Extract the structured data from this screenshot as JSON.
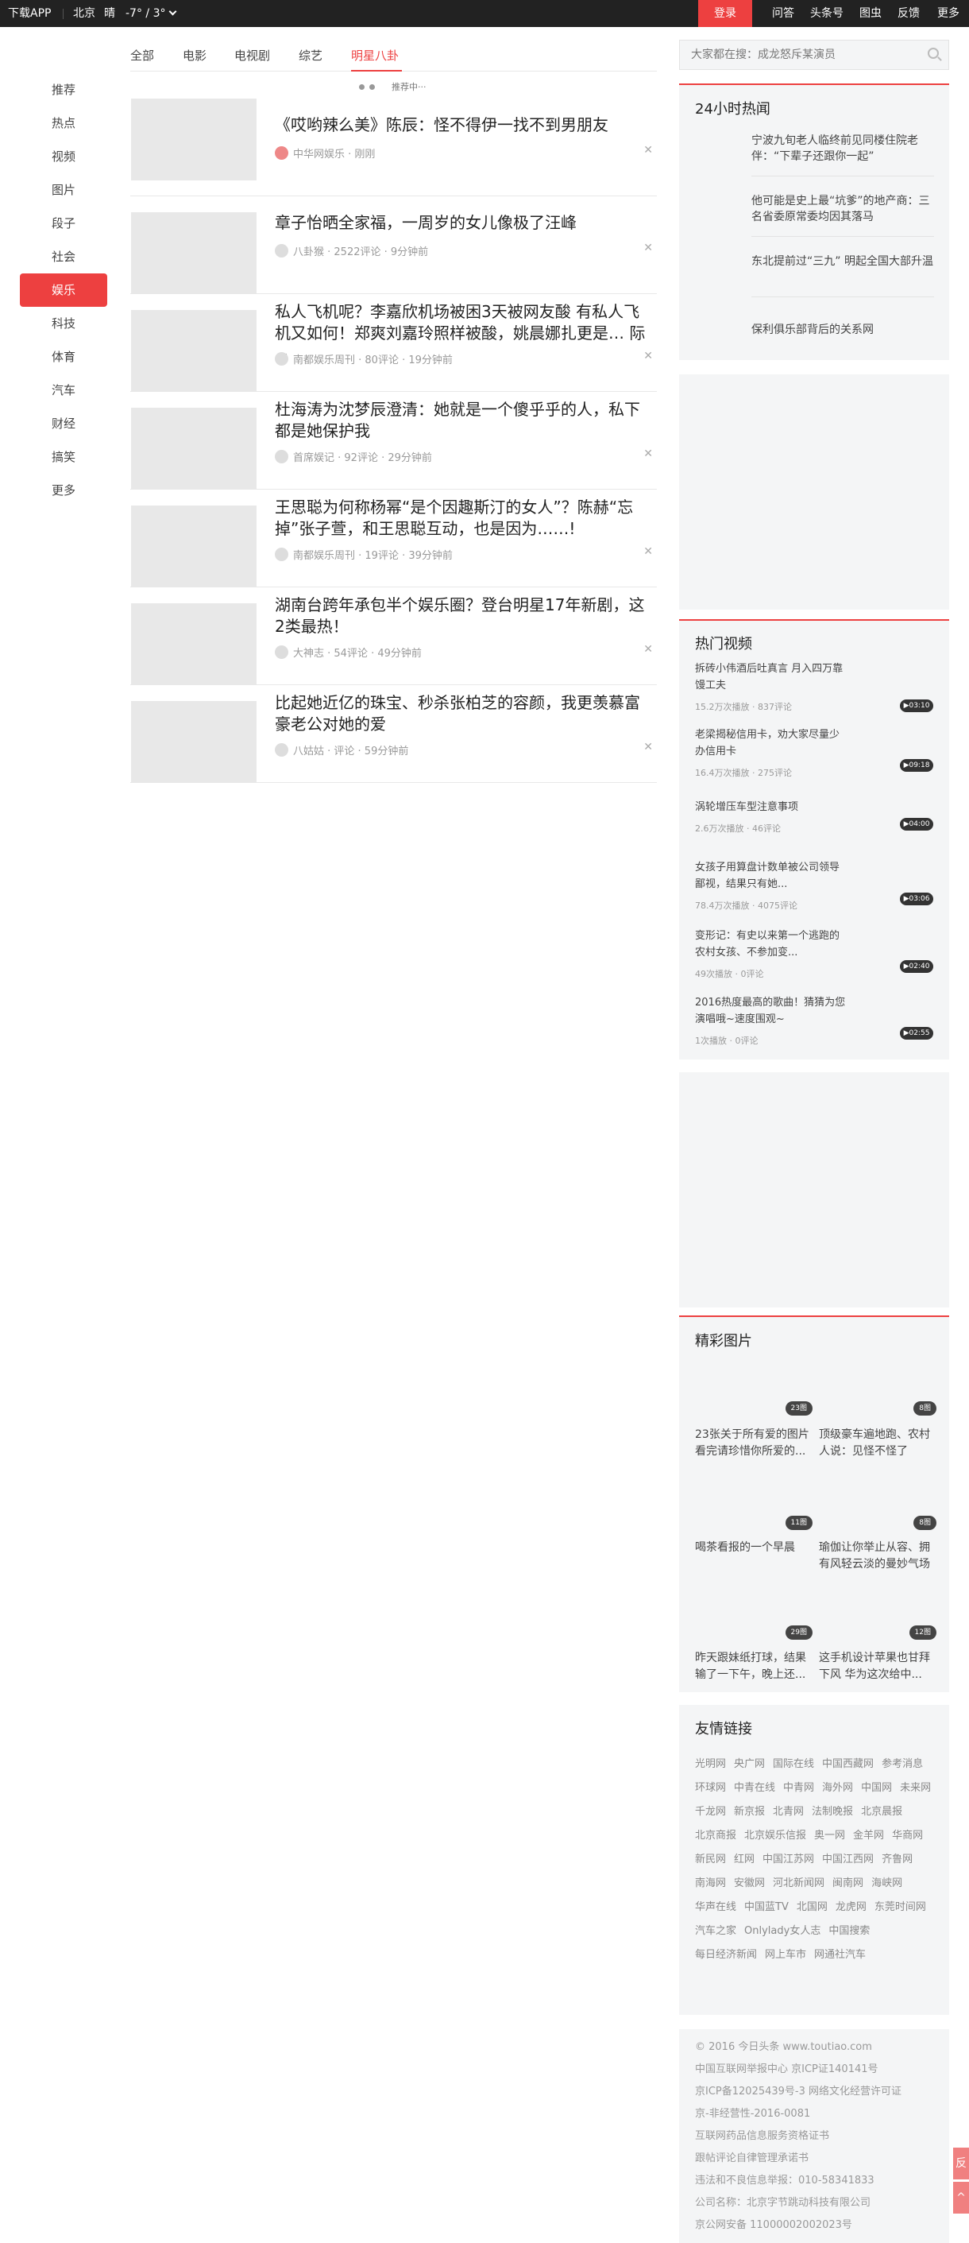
{
  "topbar": {
    "download_app": "下载APP",
    "city": "北京",
    "weather": "晴",
    "temp": "-7° / 3°",
    "login": "登录",
    "nav": [
      "问答",
      "头条号",
      "图虫",
      "反馈",
      "更多"
    ]
  },
  "sidebar": {
    "items": [
      "推荐",
      "热点",
      "视频",
      "图片",
      "段子",
      "社会",
      "娱乐",
      "科技",
      "体育",
      "汽车",
      "财经",
      "搞笑",
      "更多"
    ],
    "active": "娱乐"
  },
  "tabs": {
    "items": [
      "全部",
      "电影",
      "电视剧",
      "综艺",
      "明星八卦"
    ],
    "active": "明星八卦"
  },
  "pull_text": "推荐中···",
  "feed": [
    {
      "title": "《哎哟辣么美》陈辰：怪不得伊一找不到男朋友",
      "meta": "中华网娱乐 · 刚刚"
    },
    {
      "title": "章子怡晒全家福，一周岁的女儿像极了汪峰",
      "meta": "八卦猴 · 2522评论 · 9分钟前"
    },
    {
      "title": "私人飞机呢？李嘉欣机场被困3天被网友酸 有私人飞机又如何！郑爽刘嘉玲照样被酸，姚晨娜扎更是… 际~",
      "meta": "南都娱乐周刊 · 80评论 · 19分钟前"
    },
    {
      "title": "杜海涛为沈梦辰澄清：她就是一个傻乎乎的人，私下都是她保护我",
      "meta": "首席娱记 · 92评论 · 29分钟前"
    },
    {
      "title": "王思聪为何称杨幂“是个因趣斯汀的女人”？陈赫“忘掉”张子萱，和王思聪互动，也是因为……!",
      "meta": "南都娱乐周刊 · 19评论 · 39分钟前"
    },
    {
      "title": "湖南台跨年承包半个娱乐圈？登台明星17年新剧，这2类最热！",
      "meta": "大神志 · 54评论 · 49分钟前"
    },
    {
      "title": "比起她近亿的珠宝、秒杀张柏芝的容颜，我更羡慕富豪老公对她的爱",
      "meta": "八姑姑 · 评论 · 59分钟前"
    }
  ],
  "search": {
    "placeholder": "大家都在搜：成龙怒斥某演员"
  },
  "hot24": {
    "title": "24小时热闻",
    "items": [
      "宁波九旬老人临终前见同楼住院老伴：“下辈子还跟你一起”",
      "他可能是史上最“坑爹”的地产商：三名省委原常委均因其落马",
      "东北提前过“三九” 明起全国大部升温",
      "保利俱乐部背后的关系网"
    ]
  },
  "hotvideo": {
    "title": "热门视频",
    "items": [
      {
        "title": "拆砖小伟酒后吐真言 月入四万靠馒工夫",
        "meta": "15.2万次播放 · 837评论",
        "dur": "▶03:10"
      },
      {
        "title": "老梁揭秘信用卡，劝大家尽量少办信用卡",
        "meta": "16.4万次播放 · 275评论",
        "dur": "▶09:18"
      },
      {
        "title": "涡轮增压车型注意事项",
        "meta": "2.6万次播放 · 46评论",
        "dur": "▶04:00"
      },
      {
        "title": "女孩子用算盘计数单被公司领导鄙视，结果只有她...",
        "meta": "78.4万次播放 · 4075评论",
        "dur": "▶03:06"
      },
      {
        "title": "变形记：有史以来第一个逃跑的农村女孩、不参加变...",
        "meta": "49次播放 · 0评论",
        "dur": "▶02:40"
      },
      {
        "title": "2016热度最高的歌曲！猜猜为您演唱哦~速度围观~",
        "meta": "1次播放 · 0评论",
        "dur": "▶02:55"
      }
    ]
  },
  "pictures": {
    "title": "精彩图片",
    "items": [
      {
        "title": "23张关于所有爱的图片 看完请珍惜你所爱的...",
        "badge": "23图"
      },
      {
        "title": "顶级豪车遍地跑、农村人说：见怪不怪了",
        "badge": "8图"
      },
      {
        "title": "喝茶看报的一个早晨",
        "badge": "11图"
      },
      {
        "title": "瑜伽让你举止从容、拥有风轻云淡的曼妙气场",
        "badge": "8图"
      },
      {
        "title": "昨天跟妹纸打球，结果输了一下午，晚上还...",
        "badge": "29图"
      },
      {
        "title": "这手机设计苹果也甘拜下风 华为这次给中...",
        "badge": "12图"
      }
    ]
  },
  "friend_links": {
    "title": "友情链接",
    "items": [
      "光明网",
      "央广网",
      "国际在线",
      "中国西藏网",
      "参考消息",
      "环球网",
      "中青在线",
      "中青网",
      "海外网",
      "中国网",
      "未来网",
      "千龙网",
      "新京报",
      "北青网",
      "法制晚报",
      "北京晨报",
      "北京商报",
      "北京娱乐信报",
      "奥一网",
      "金羊网",
      "华商网",
      "新民网",
      "红网",
      "中国江苏网",
      "中国江西网",
      "齐鲁网",
      "南海网",
      "安徽网",
      "河北新闻网",
      "闽南网",
      "海峡网",
      "华声在线",
      "中国蓝TV",
      "北国网",
      "龙虎网",
      "东莞时间网",
      "汽车之家",
      "Onlylady女人志",
      "中国搜索",
      "每日经济新闻",
      "网上车市",
      "网通社汽车"
    ]
  },
  "footer": [
    "© 2016 今日头条 www.toutiao.com",
    "中国互联网举报中心 京ICP证140141号",
    "京ICP备12025439号-3 网络文化经营许可证",
    "京-非经营性-2016-0081",
    "互联网药品信息服务资格证书",
    "跟帖评论自律管理承诺书",
    "违法和不良信息举报：010-58341833",
    "公司名称：北京字节跳动科技有限公司",
    "京公网安备 11000002002023号"
  ],
  "float_buttons": [
    "反",
    "^"
  ]
}
